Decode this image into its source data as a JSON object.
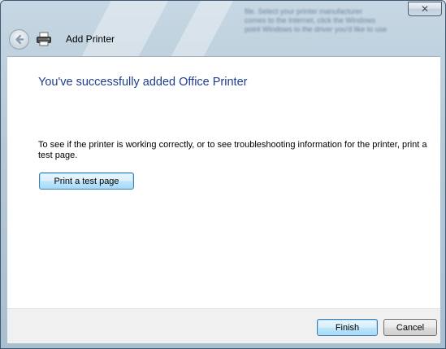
{
  "window": {
    "title": "Add Printer",
    "close_glyph": "✕",
    "background_text": [
      "file. Select your printer manufacturer",
      "comes to the Internet, click the Windows",
      "point Windows to the driver you'd like to use"
    ]
  },
  "nav": {
    "back_icon": "back-arrow-icon",
    "app_icon": "printer-icon"
  },
  "content": {
    "headline": "You've successfully added Office Printer",
    "description": "To see if the printer is working correctly, or to see troubleshooting information for the printer, print a test page.",
    "test_button_label": "Print a test page"
  },
  "footer": {
    "finish_label": "Finish",
    "cancel_label": "Cancel"
  },
  "colors": {
    "headline": "#1f3d8f",
    "frame": "#b5c9d8",
    "default_button": "#bee6fd"
  }
}
